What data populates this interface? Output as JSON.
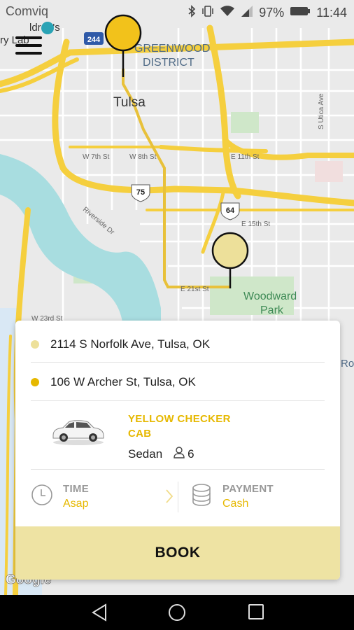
{
  "status": {
    "carrier": "Comviq",
    "battery": "97%",
    "time": "11:44"
  },
  "map": {
    "labels": {
      "childrens_lab": "ldren's",
      "childrens_lab2": "ry Lab",
      "district1": "GREENWOOD",
      "district2": "DISTRICT",
      "city": "Tulsa",
      "w7th": "W 7th St",
      "w8th": "W 8th St",
      "e11th": "E 11th St",
      "e15th": "E 15th St",
      "e21st": "E 21st St",
      "riverside": "Riverside Dr",
      "w23rd": "W 23rd St",
      "utica": "S Utica Ave",
      "woodward1": "Woodward",
      "woodward2": "Park",
      "rood": "Rood",
      "shield_244": "244",
      "shield_75": "75",
      "shield_64": "64",
      "google": "Google"
    }
  },
  "trip": {
    "pickup": "2114 S Norfolk Ave, Tulsa, OK",
    "dropoff": "106 W Archer St, Tulsa, OK"
  },
  "vehicle": {
    "company_line1": "YELLOW CHECKER",
    "company_line2": "CAB",
    "type": "Sedan",
    "seats": "6"
  },
  "options": {
    "time_label": "TIME",
    "time_value": "Asap",
    "payment_label": "PAYMENT",
    "payment_value": "Cash"
  },
  "book_label": "BOOK",
  "colors": {
    "accent": "#e6b800",
    "pin_active": "#f2c21b",
    "pin_pale": "#ede09a",
    "book_bg": "#eee3a3",
    "route": "#e8c13a"
  },
  "icons": {
    "menu": "hamburger-menu-icon",
    "clock": "clock-icon",
    "payment": "coins-stack-icon",
    "person": "person-icon",
    "chevron": "chevron-right-icon",
    "back": "nav-back-icon",
    "home": "nav-home-icon",
    "recents": "nav-recents-icon"
  }
}
